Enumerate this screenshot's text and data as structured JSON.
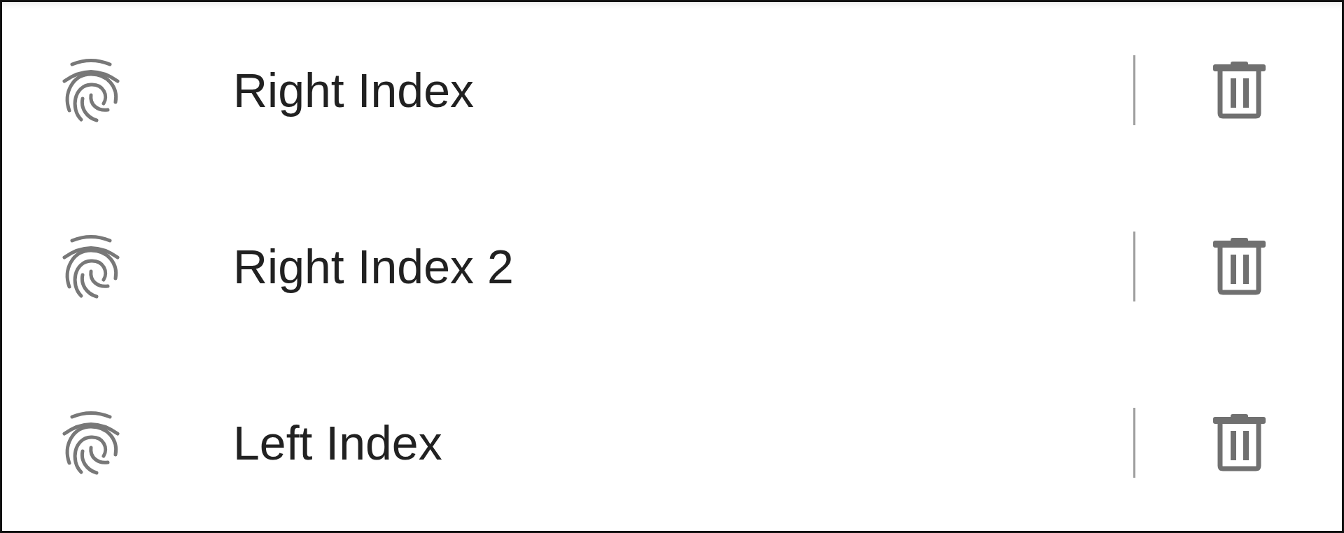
{
  "fingerprints": [
    {
      "name": "Right Index"
    },
    {
      "name": "Right Index 2"
    },
    {
      "name": "Left Index"
    }
  ]
}
